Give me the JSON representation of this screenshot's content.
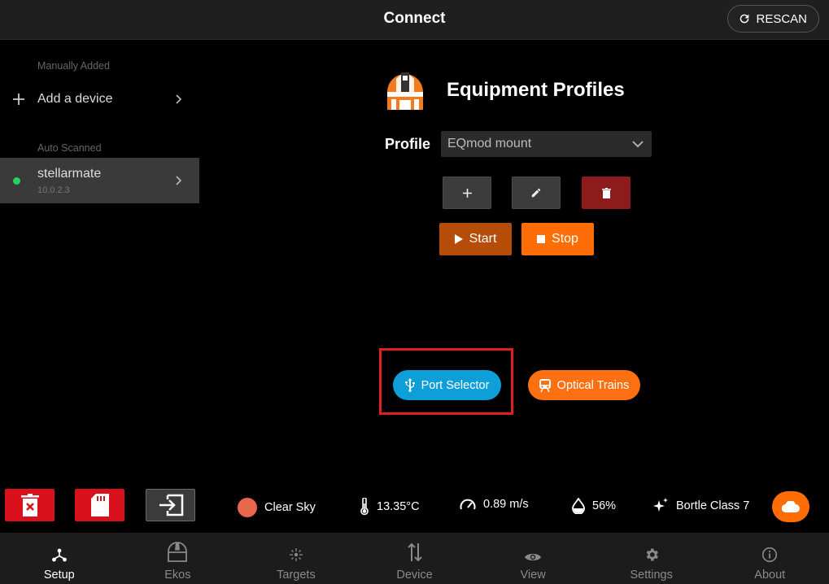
{
  "header": {
    "title": "Connect",
    "rescan_label": "RESCAN"
  },
  "sidebar": {
    "manual_section": "Manually Added",
    "add_device_label": "Add a device",
    "auto_section": "Auto Scanned",
    "devices": [
      {
        "name": "stellarmate",
        "ip": "10.0.2.3",
        "status_color": "#27d35a"
      }
    ]
  },
  "profiles": {
    "title": "Equipment Profiles",
    "profile_label": "Profile",
    "selected_profile": "EQmod mount",
    "start_label": "Start",
    "stop_label": "Stop"
  },
  "tools": {
    "port_selector_label": "Port Selector",
    "optical_trains_label": "Optical Trains"
  },
  "status_bar": {
    "sky": "Clear Sky",
    "temperature": "13.35°C",
    "wind": "0.89 m/s",
    "humidity": "56%",
    "bortle": "Bortle Class 7"
  },
  "nav": {
    "items": [
      "Setup",
      "Ekos",
      "Targets",
      "Device",
      "View",
      "Settings",
      "About"
    ],
    "active": "Setup"
  },
  "colors": {
    "accent": "#fe6d06",
    "start": "#b54c08",
    "port": "#0e9fd8",
    "danger": "#d8111c",
    "highlight": "#e0201f"
  }
}
